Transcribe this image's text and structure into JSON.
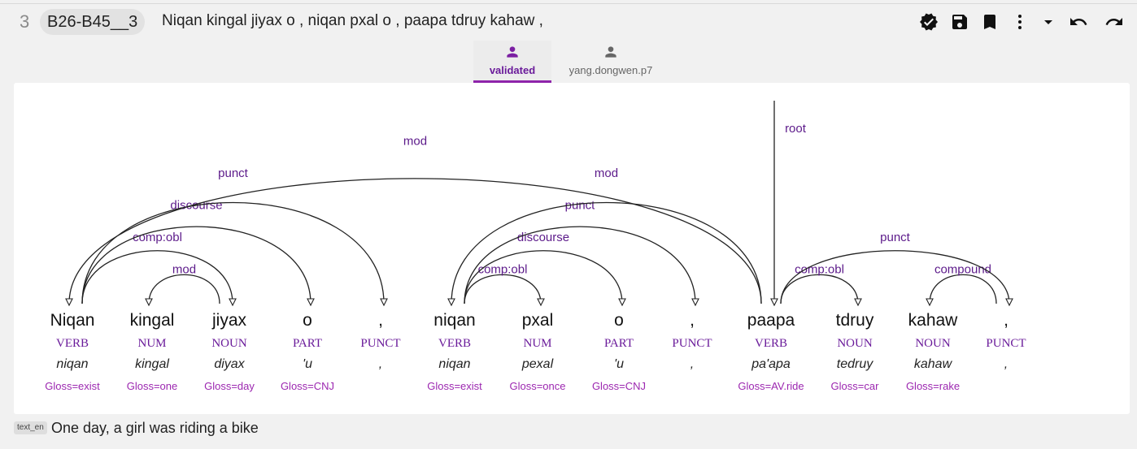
{
  "header": {
    "sentence_number": "3",
    "sentence_id": "B26-B45__3",
    "sentence_text": "Niqan kingal jiyax o , niqan pxal o , paapa tdruy kahaw ,"
  },
  "toolbar": [
    {
      "name": "validated-check-icon"
    },
    {
      "name": "save-icon"
    },
    {
      "name": "bookmark-icon"
    },
    {
      "name": "more-vert-icon"
    },
    {
      "name": "dropdown-arrow-icon"
    },
    {
      "name": "undo-icon"
    },
    {
      "name": "redo-icon"
    }
  ],
  "tabs": [
    {
      "label": "validated",
      "icon": "person-icon",
      "active": true
    },
    {
      "label": "yang.dongwen.p7",
      "icon": "person-icon",
      "active": false
    }
  ],
  "tokens": [
    {
      "form": "Niqan",
      "upos": "VERB",
      "lemma": "niqan",
      "gloss": "Gloss=exist"
    },
    {
      "form": "kingal",
      "upos": "NUM",
      "lemma": "kingal",
      "gloss": "Gloss=one"
    },
    {
      "form": "jiyax",
      "upos": "NOUN",
      "lemma": "diyax",
      "gloss": "Gloss=day"
    },
    {
      "form": "o",
      "upos": "PART",
      "lemma": "'u",
      "gloss": "Gloss=CNJ"
    },
    {
      "form": ",",
      "upos": "PUNCT",
      "lemma": ",",
      "gloss": ""
    },
    {
      "form": "niqan",
      "upos": "VERB",
      "lemma": "niqan",
      "gloss": "Gloss=exist"
    },
    {
      "form": "pxal",
      "upos": "NUM",
      "lemma": "pexal",
      "gloss": "Gloss=once"
    },
    {
      "form": "o",
      "upos": "PART",
      "lemma": "'u",
      "gloss": "Gloss=CNJ"
    },
    {
      "form": ",",
      "upos": "PUNCT",
      "lemma": ",",
      "gloss": ""
    },
    {
      "form": "paapa",
      "upos": "VERB",
      "lemma": "pa'apa",
      "gloss": "Gloss=AV.ride"
    },
    {
      "form": "tdruy",
      "upos": "NOUN",
      "lemma": "tedruy",
      "gloss": "Gloss=car"
    },
    {
      "form": "kahaw",
      "upos": "NOUN",
      "lemma": "kahaw",
      "gloss": "Gloss=rake"
    },
    {
      "form": ",",
      "upos": "PUNCT",
      "lemma": ",",
      "gloss": ""
    }
  ],
  "relations": [
    {
      "head": 0,
      "dep": 2,
      "label": "comp:obl"
    },
    {
      "head": 2,
      "dep": 1,
      "label": "mod"
    },
    {
      "head": 0,
      "dep": 3,
      "label": "discourse"
    },
    {
      "head": 0,
      "dep": 4,
      "label": "punct"
    },
    {
      "head": 9,
      "dep": 0,
      "label": "mod"
    },
    {
      "head": 5,
      "dep": 6,
      "label": "comp:obl"
    },
    {
      "head": 5,
      "dep": 7,
      "label": "discourse"
    },
    {
      "head": 5,
      "dep": 8,
      "label": "punct"
    },
    {
      "head": 9,
      "dep": 5,
      "label": "mod"
    },
    {
      "head": 9,
      "dep": 10,
      "label": "comp:obl"
    },
    {
      "head": 12,
      "dep": 11,
      "label": "compound"
    },
    {
      "head": 9,
      "dep": 12,
      "label": "punct"
    }
  ],
  "root": {
    "token": 9,
    "label": "root"
  },
  "metadata": {
    "tag": "text_en",
    "translation": "One day, a girl was riding a bike"
  }
}
